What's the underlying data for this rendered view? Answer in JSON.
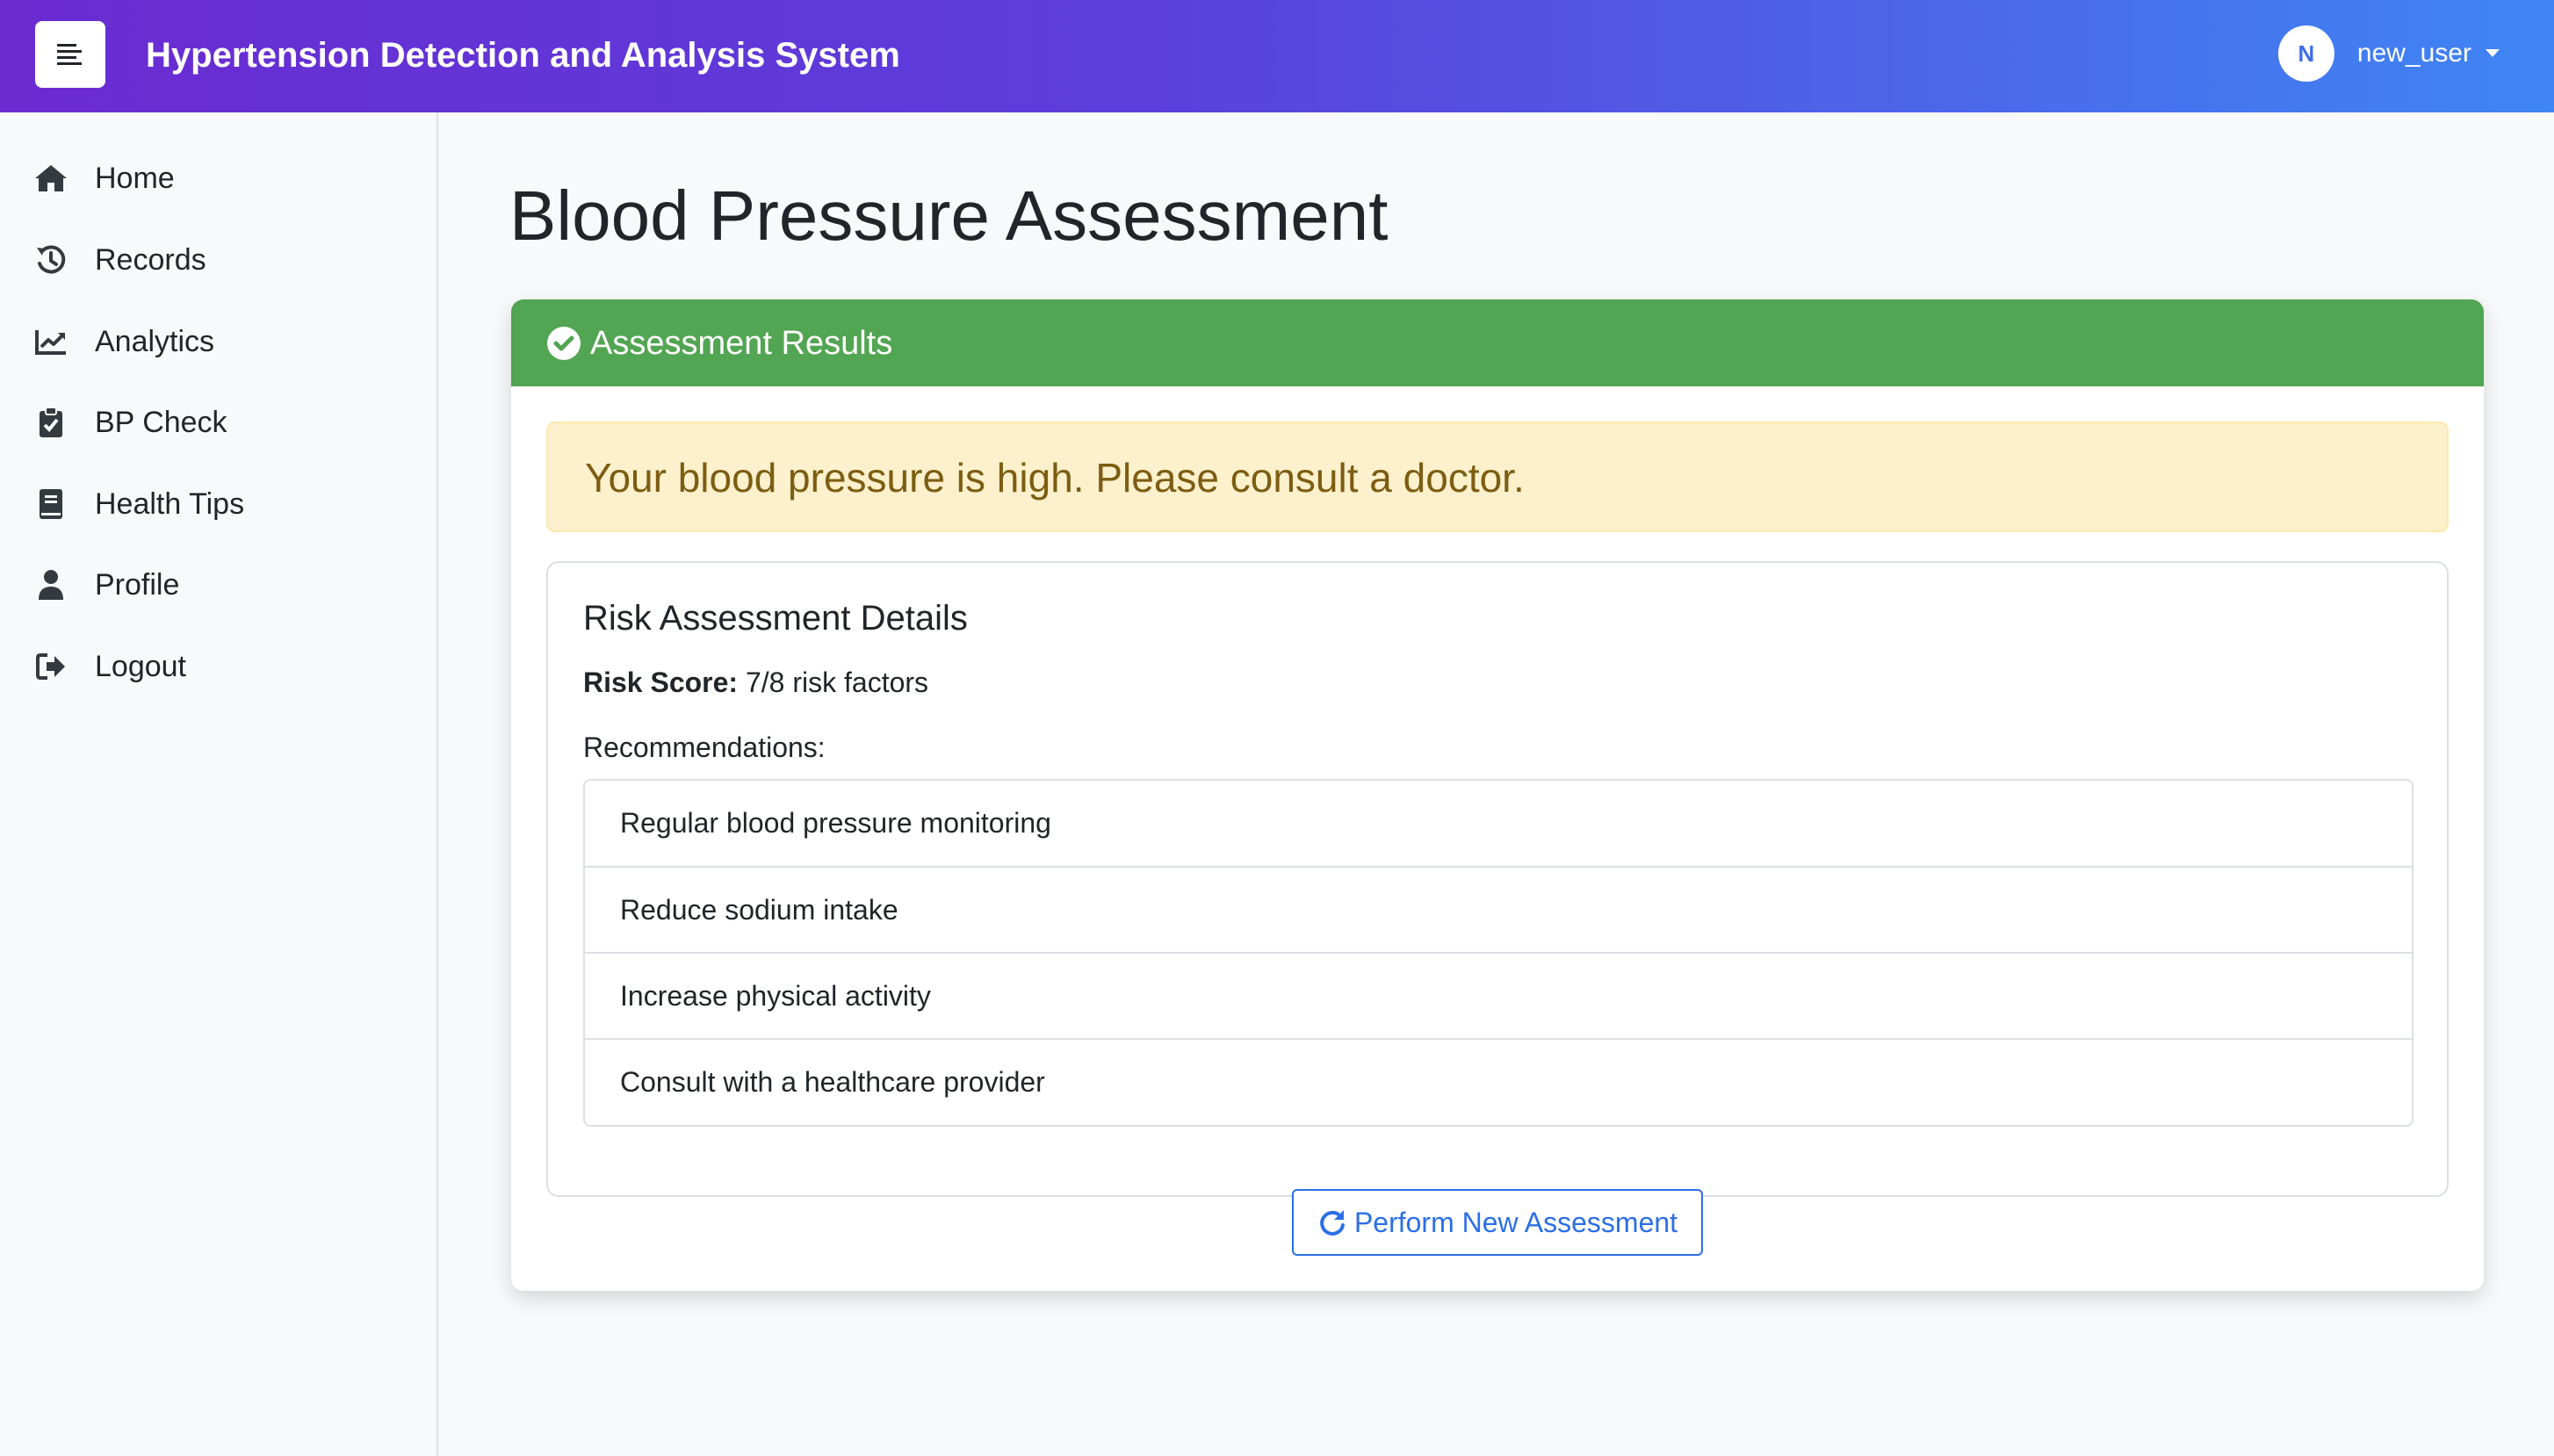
{
  "app": {
    "title": "Hypertension Detection and Analysis System"
  },
  "user": {
    "initial": "N",
    "name": "new_user"
  },
  "sidebar": {
    "items": [
      {
        "label": "Home",
        "icon": "home-icon"
      },
      {
        "label": "Records",
        "icon": "history-icon"
      },
      {
        "label": "Analytics",
        "icon": "chart-line-icon"
      },
      {
        "label": "BP Check",
        "icon": "clipboard-check-icon"
      },
      {
        "label": "Health Tips",
        "icon": "book-icon"
      },
      {
        "label": "Profile",
        "icon": "user-icon"
      },
      {
        "label": "Logout",
        "icon": "sign-out-icon"
      }
    ]
  },
  "main": {
    "page_title": "Blood Pressure Assessment",
    "card": {
      "header": "Assessment Results",
      "alert": "Your blood pressure is high. Please consult a doctor.",
      "details_title": "Risk Assessment Details",
      "risk_score_label": "Risk Score:",
      "risk_score_value": "7/8 risk factors",
      "recommendations_label": "Recommendations:",
      "recommendations": [
        "Regular blood pressure monitoring",
        "Reduce sodium intake",
        "Increase physical activity",
        "Consult with a healthcare provider"
      ],
      "new_assessment_button": "Perform New Assessment"
    }
  },
  "colors": {
    "navbar_start": "#6a2bd1",
    "navbar_end": "#3f86f4",
    "success_header": "#52a552",
    "warning_bg": "#fdf1cd",
    "warning_text": "#7d5d12",
    "primary": "#2b6fe6"
  }
}
